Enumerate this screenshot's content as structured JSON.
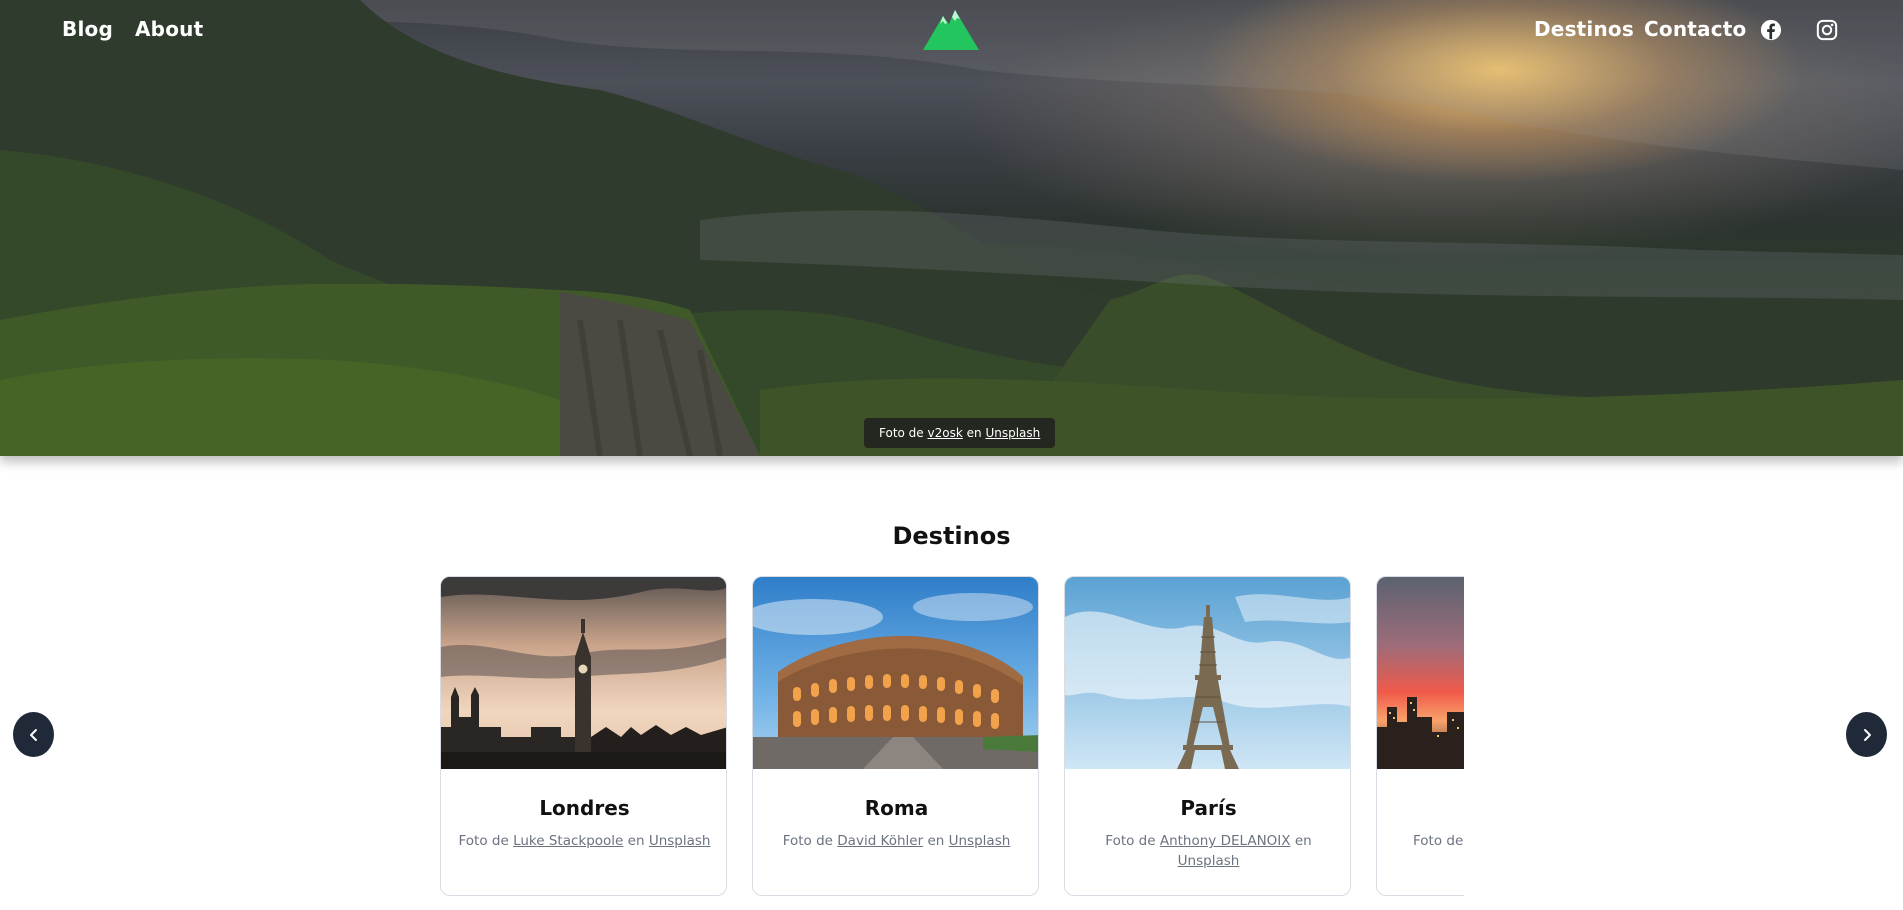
{
  "nav": {
    "blog": "Blog",
    "about": "About",
    "destinos": "Destinos",
    "contacto": "Contacto",
    "facebook_icon": "facebook-icon",
    "instagram_icon": "instagram-icon",
    "logo_icon": "mountain-logo-icon",
    "brand_color": "#22c55e"
  },
  "hero": {
    "credit_prefix": "Foto de",
    "credit_author": "v2osk",
    "credit_middle": "en",
    "credit_source": "Unsplash"
  },
  "destinations": {
    "title": "Destinos",
    "cards": [
      {
        "name": "Londres",
        "credit_prefix": "Foto de",
        "author": "Luke Stackpoole",
        "middle": "en",
        "source": "Unsplash"
      },
      {
        "name": "Roma",
        "credit_prefix": "Foto de",
        "author": "David Köhler",
        "middle": "en",
        "source": "Unsplash"
      },
      {
        "name": "París",
        "credit_prefix": "Foto de",
        "author": "Anthony DELANOIX",
        "middle": "en",
        "source": "Unsplash"
      },
      {
        "credit_prefix": "Foto de"
      }
    ],
    "prev_icon": "chevron-left-icon",
    "next_icon": "chevron-right-icon"
  },
  "colors": {
    "arrow_bg": "#1f2937",
    "credit_text": "#6b7280"
  }
}
